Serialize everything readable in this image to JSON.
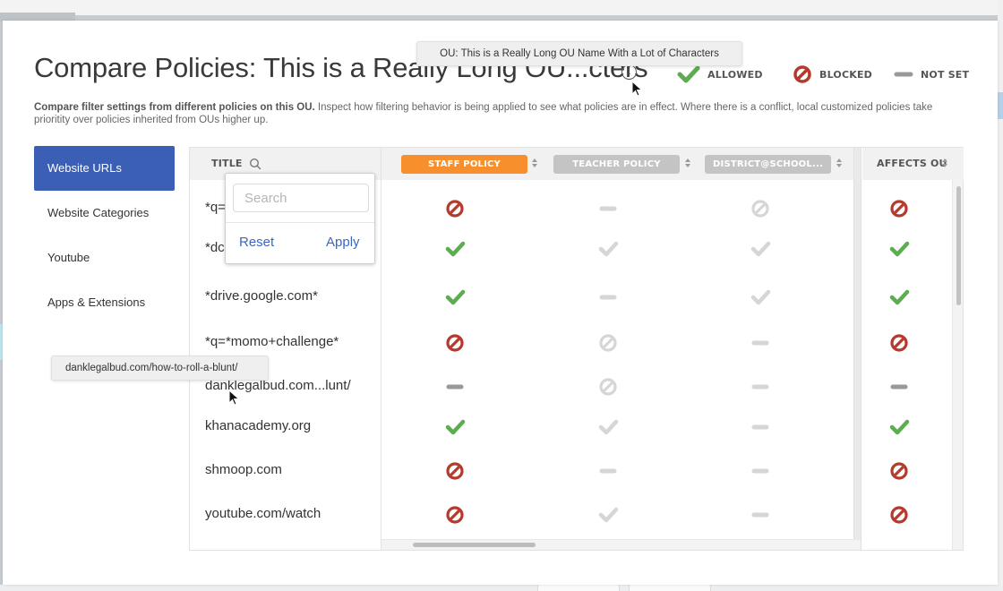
{
  "page": {
    "title": "Compare Policies:  This is a Really Long OU...cters",
    "description_bold": "Compare filter settings from different policies on this OU.",
    "description_rest": " Inspect how filtering behavior is being applied to see what policies are in effect. Where there is a conflict, local customized policies take prioritity over policies inherited from OUs higher up.",
    "info_icon": "info-icon",
    "ou_tooltip": "OU: This is a Really Long OU Name With a Lot of Characters"
  },
  "legend": [
    {
      "icon": "check-icon",
      "label": "ALLOWED"
    },
    {
      "icon": "blocked-icon",
      "label": "BLOCKED"
    },
    {
      "icon": "dash-icon",
      "label": "NOT SET"
    }
  ],
  "colors": {
    "allowed": "#5cad4f",
    "blocked": "#b33a2c",
    "not_set_active": "#999999",
    "inactive": "#d6d6d6",
    "accent_blue": "#3b5fb5",
    "staff_policy": "#f7902c",
    "policy_inactive": "#c4c4c4",
    "link_blue": "#3b66c4"
  },
  "sidebar": {
    "items": [
      {
        "label": "Website URLs",
        "active": true
      },
      {
        "label": "Website Categories",
        "active": false
      },
      {
        "label": "Youtube",
        "active": false
      },
      {
        "label": "Apps & Extensions",
        "active": false
      }
    ]
  },
  "table": {
    "title_header": "TITLE",
    "search_icon": "search-icon",
    "policies": [
      {
        "label": "STAFF POLICY",
        "selected": true
      },
      {
        "label": "TEACHER POLICY",
        "selected": false
      },
      {
        "label": "DISTRICT@SCHOOL...",
        "selected": false
      }
    ],
    "affects_header": "AFFECTS OU",
    "rows": [
      {
        "title": "*q=",
        "states": [
          [
            "blocked",
            true
          ],
          [
            "notset",
            false
          ],
          [
            "blocked",
            false
          ]
        ],
        "affects": [
          "blocked",
          true
        ]
      },
      {
        "title": "*dc",
        "states": [
          [
            "allowed",
            true
          ],
          [
            "allowed",
            false
          ],
          [
            "allowed",
            false
          ]
        ],
        "affects": [
          "allowed",
          true
        ]
      },
      {
        "title": "*drive.google.com*",
        "states": [
          [
            "allowed",
            true
          ],
          [
            "notset",
            false
          ],
          [
            "allowed",
            false
          ]
        ],
        "affects": [
          "allowed",
          true
        ]
      },
      {
        "title": "*q=*momo+challenge*",
        "states": [
          [
            "blocked",
            true
          ],
          [
            "blocked",
            false
          ],
          [
            "notset",
            false
          ]
        ],
        "affects": [
          "blocked",
          true
        ]
      },
      {
        "title": "danklegalbud.com...lunt/",
        "states": [
          [
            "notset",
            true
          ],
          [
            "blocked",
            false
          ],
          [
            "notset",
            false
          ]
        ],
        "affects": [
          "notset",
          true
        ]
      },
      {
        "title": "khanacademy.org",
        "states": [
          [
            "allowed",
            true
          ],
          [
            "allowed",
            false
          ],
          [
            "notset",
            false
          ]
        ],
        "affects": [
          "allowed",
          true
        ]
      },
      {
        "title": "shmoop.com",
        "states": [
          [
            "blocked",
            true
          ],
          [
            "notset",
            false
          ],
          [
            "notset",
            false
          ]
        ],
        "affects": [
          "blocked",
          true
        ]
      },
      {
        "title": "youtube.com/watch",
        "states": [
          [
            "blocked",
            true
          ],
          [
            "allowed",
            false
          ],
          [
            "notset",
            false
          ]
        ],
        "affects": [
          "blocked",
          true
        ]
      }
    ],
    "url_tooltip": "danklegalbud.com/how-to-roll-a-blunt/"
  },
  "search_popover": {
    "placeholder": "Search",
    "value": "",
    "reset_label": "Reset",
    "apply_label": "Apply"
  }
}
